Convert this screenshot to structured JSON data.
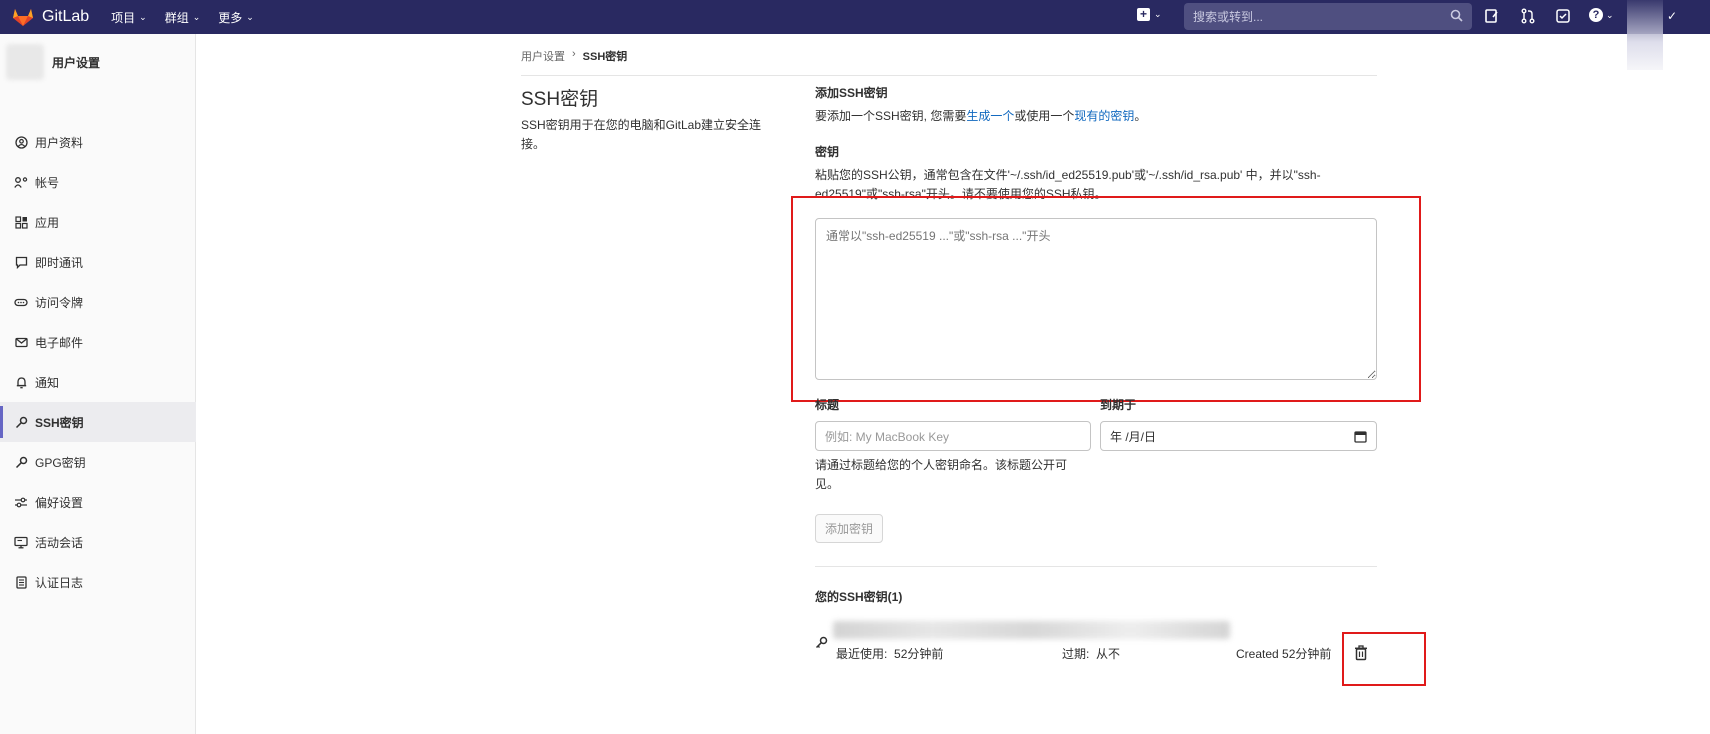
{
  "topbar": {
    "brand": "GitLab",
    "menu": [
      "项目",
      "群组",
      "更多"
    ],
    "search_placeholder": "搜索或转到..."
  },
  "sidebar": {
    "title": "用户设置",
    "items": [
      {
        "label": "用户资料",
        "icon": "profile-icon"
      },
      {
        "label": "帐号",
        "icon": "account-icon"
      },
      {
        "label": "应用",
        "icon": "applications-icon"
      },
      {
        "label": "即时通讯",
        "icon": "chat-icon"
      },
      {
        "label": "访问令牌",
        "icon": "token-icon"
      },
      {
        "label": "电子邮件",
        "icon": "email-icon"
      },
      {
        "label": "通知",
        "icon": "bell-icon"
      },
      {
        "label": "SSH密钥",
        "icon": "key-icon",
        "active": true
      },
      {
        "label": "GPG密钥",
        "icon": "key-icon"
      },
      {
        "label": "偏好设置",
        "icon": "preferences-icon"
      },
      {
        "label": "活动会话",
        "icon": "monitor-icon"
      },
      {
        "label": "认证日志",
        "icon": "log-icon"
      }
    ]
  },
  "breadcrumb": {
    "parent": "用户设置",
    "separator": "›",
    "current": "SSH密钥"
  },
  "page": {
    "title": "SSH密钥",
    "description": "SSH密钥用于在您的电脑和GitLab建立安全连接。"
  },
  "add_section": {
    "title": "添加SSH密钥",
    "intro_prefix": "要添加一个SSH密钥, 您需要",
    "intro_link1": "生成一个",
    "intro_middle": "或使用一个",
    "intro_link2": "现有的密钥",
    "intro_suffix": "。",
    "key_label": "密钥",
    "key_help": "粘贴您的SSH公钥，通常包含在文件'~/.ssh/id_ed25519.pub'或'~/.ssh/id_rsa.pub' 中，并以\"ssh-ed25519\"或\"ssh-rsa\"开头。请不要使用您的SSH私钥。",
    "key_placeholder": "通常以\"ssh-ed25519 ...\"或\"ssh-rsa ...\"开头",
    "title_label": "标题",
    "title_placeholder": "例如: My MacBook Key",
    "expires_label": "到期于",
    "expires_value": "年 /月/日",
    "title_hint": "请通过标题给您的个人密钥命名。该标题公开可见。",
    "submit_label": "添加密钥"
  },
  "keys_section": {
    "title": "您的SSH密钥(1)",
    "key": {
      "last_used_label": "最近使用:",
      "last_used_value": "52分钟前",
      "expires_label": "过期:",
      "expires_value": "从不",
      "created": "Created 52分钟前"
    }
  },
  "colors": {
    "topbar": "#292961",
    "link": "#1068bf",
    "highlight_box": "#e01a1a"
  }
}
